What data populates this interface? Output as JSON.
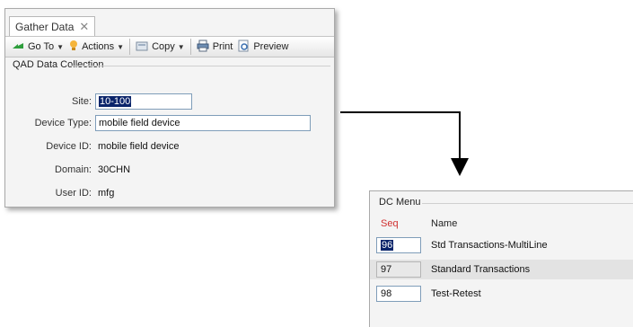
{
  "gather_window": {
    "tab_title": "Gather Data",
    "tab_close": "✕",
    "toolbar": {
      "goto_label": "Go To",
      "actions_label": "Actions",
      "copy_label": "Copy",
      "print_label": "Print",
      "preview_label": "Preview"
    },
    "group_title": "QAD Data Collection",
    "fields": {
      "site_label": "Site:",
      "site_value": "10-100",
      "device_type_label": "Device Type:",
      "device_type_value": "mobile field device",
      "device_id_label": "Device ID:",
      "device_id_value": "mobile field device",
      "domain_label": "Domain:",
      "domain_value": "30CHN",
      "user_id_label": "User ID:",
      "user_id_value": "mfg"
    }
  },
  "dc_menu": {
    "group_title": "DC Menu",
    "col_seq": "Seq",
    "col_name": "Name",
    "rows": [
      {
        "seq": "96",
        "name": "Std Transactions-MultiLine"
      },
      {
        "seq": "97",
        "name": "Standard Transactions"
      },
      {
        "seq": "98",
        "name": "Test-Retest"
      }
    ]
  },
  "colors": {
    "selection": "#0a246a",
    "seq_header": "#d03030",
    "field_border": "#7f9db9"
  },
  "icons": [
    "goto-arrow-icon",
    "actions-bulb-icon",
    "copy-icon",
    "print-icon",
    "preview-icon",
    "chevron-down-icon"
  ]
}
